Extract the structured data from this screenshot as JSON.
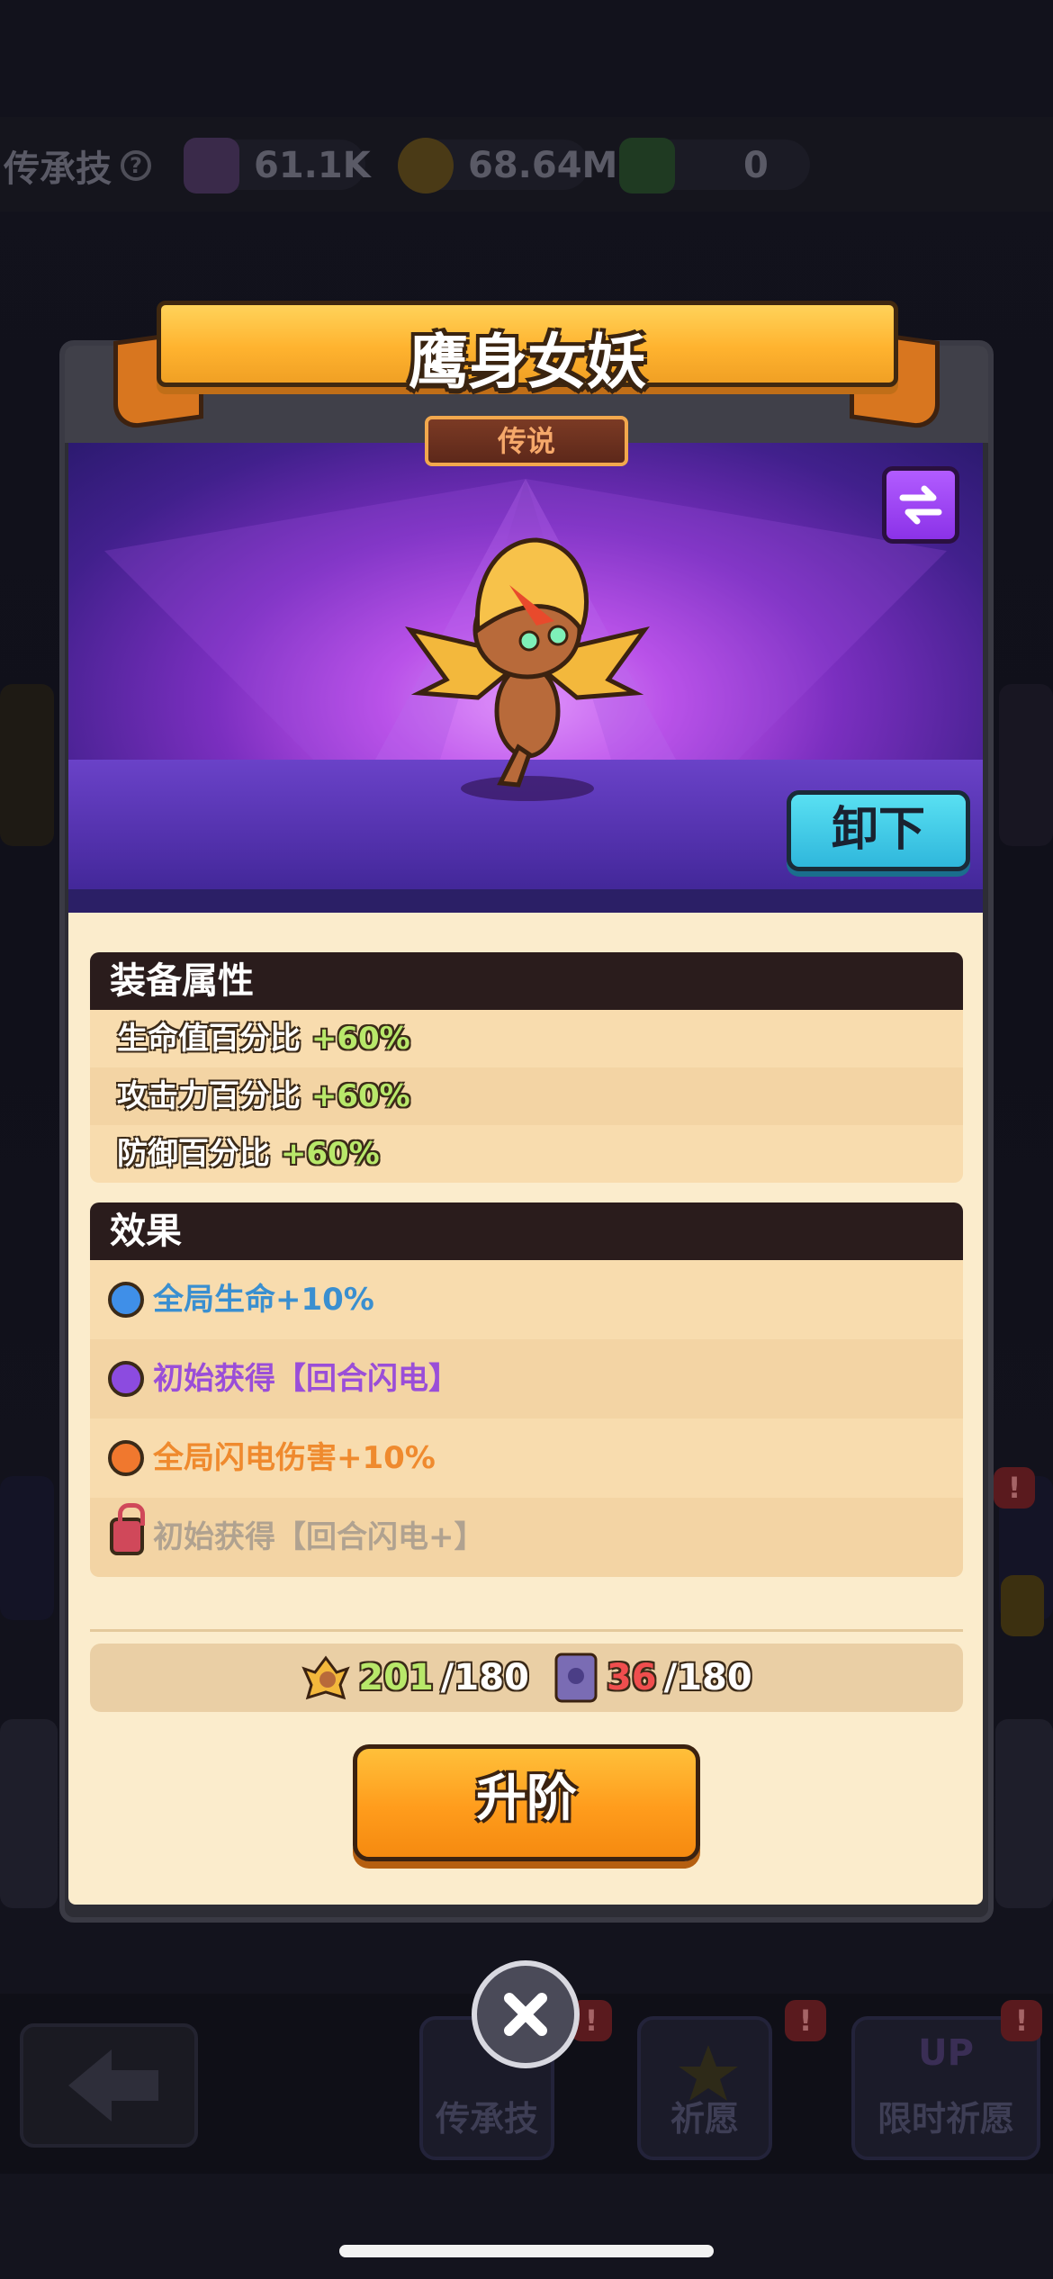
{
  "topbar": {
    "skill_label": "传承技",
    "gems": "61.1K",
    "gold": "68.64M",
    "shards": "0"
  },
  "bottom_nav": {
    "items": [
      {
        "label": "传承技",
        "badge": "!"
      },
      {
        "label": "祈愿",
        "badge": "!"
      },
      {
        "label": "限时祈愿",
        "badge": "!"
      }
    ],
    "up_tag": "UP"
  },
  "modal": {
    "title": "鹰身女妖",
    "rarity": "传说",
    "unequip_label": "卸下",
    "attributes_header": "装备属性",
    "attributes": [
      {
        "label": "生命值百分比",
        "value": "+60%"
      },
      {
        "label": "攻击力百分比",
        "value": "+60%"
      },
      {
        "label": "防御百分比",
        "value": "+60%"
      }
    ],
    "effects_header": "效果",
    "effects": [
      {
        "text": "全局生命+10%",
        "color": "#3a8fd0",
        "dot": "#3f8fe8",
        "locked": false
      },
      {
        "text": "初始获得【回合闪电】",
        "color": "#9a4ed8",
        "dot": "#8c4be0",
        "locked": false
      },
      {
        "text": "全局闪电伤害+10%",
        "color": "#ef8a2e",
        "dot": "#f0782e",
        "locked": false
      },
      {
        "text": "初始获得【回合闪电+】",
        "color": "#b0a290",
        "dot": "",
        "locked": true
      }
    ],
    "resources": {
      "shard_have": "201",
      "shard_need": "/180",
      "book_have": "36",
      "book_need": "/180"
    },
    "upgrade_label": "升阶"
  }
}
